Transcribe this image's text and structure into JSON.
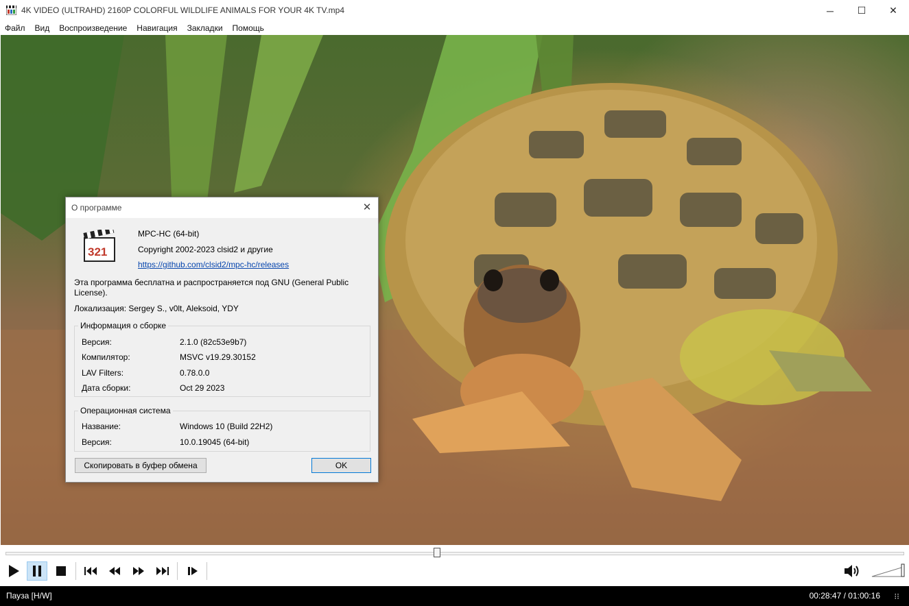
{
  "window": {
    "title": "4K VIDEO (ULTRAHD) 2160P COLORFUL WILDLIFE ANIMALS FOR YOUR 4K TV.mp4",
    "minimize": "─",
    "maximize": "☐",
    "close": "✕"
  },
  "menu": {
    "items": [
      {
        "label": "Файл"
      },
      {
        "label": "Вид"
      },
      {
        "label": "Воспроизведение"
      },
      {
        "label": "Навигация"
      },
      {
        "label": "Закладки"
      },
      {
        "label": "Помощь"
      }
    ]
  },
  "dialog": {
    "title": "О программе",
    "close": "✕",
    "logo_text": "321",
    "product": "MPC-HC (64-bit)",
    "copyright": "Copyright 2002-2023 clsid2 и другие",
    "link": "https://github.com/clsid2/mpc-hc/releases",
    "license_line1": "Эта программа бесплатна и распространяется под GNU (General Public",
    "license_line2": "License).",
    "localization": "Локализация: Sergey S., v0lt, Aleksoid, YDY",
    "build": {
      "label": "Информация о сборке",
      "rows": [
        {
          "key": "Версия:",
          "value": "2.1.0 (82c53e9b7)"
        },
        {
          "key": "Компилятор:",
          "value": "MSVC v19.29.30152"
        },
        {
          "key": "LAV Filters:",
          "value": "0.78.0.0"
        },
        {
          "key": "Дата сборки:",
          "value": "Oct 29 2023"
        }
      ]
    },
    "os": {
      "label": "Операционная система",
      "rows": [
        {
          "key": "Название:",
          "value": "Windows 10 (Build 22H2)"
        },
        {
          "key": "Версия:",
          "value": "10.0.19045 (64-bit)"
        }
      ]
    },
    "copy_button": "Скопировать в буфер обмена",
    "ok_button": "OK"
  },
  "player": {
    "seek_position": 0.48,
    "volume_level": 1.0
  },
  "status": {
    "state": "Пауза [H/W]",
    "time": "00:28:47 / 01:00:16"
  },
  "colors": {
    "status_bg": "#000000",
    "active_button": "#cce4f7",
    "link": "#0645ad"
  }
}
